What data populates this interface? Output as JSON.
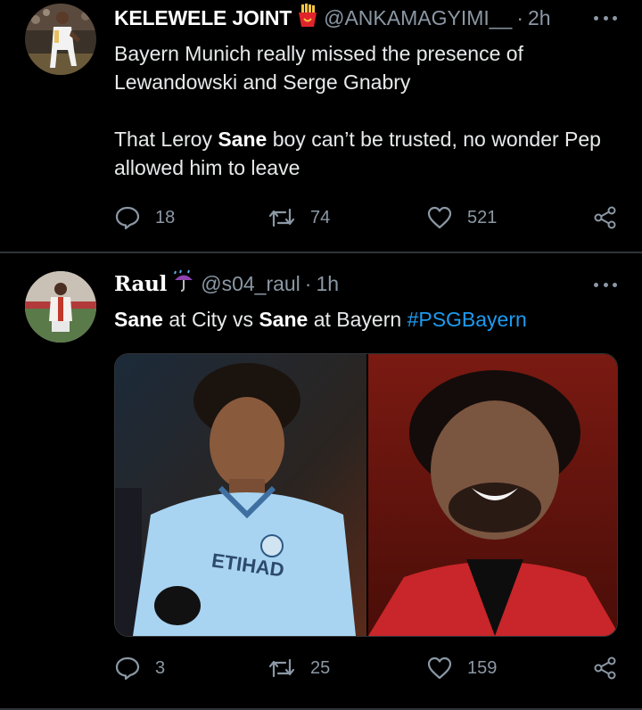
{
  "tweets": [
    {
      "display_name": "KELEWELE JOINT",
      "name_emoji": "fries-emoji",
      "handle": "@ANKAMAGYIMI__",
      "separator": "·",
      "time": "2h",
      "paragraph1": "Bayern Munich really missed the presence of Lewandowski and Serge Gnabry",
      "paragraph2_prefix": "That Leroy ",
      "paragraph2_bold": "Sane",
      "paragraph2_suffix": " boy can’t be trusted, no wonder Pep allowed him to leave",
      "replies": "18",
      "retweets": "74",
      "likes": "521"
    },
    {
      "display_name": "Raul",
      "name_emoji": "umbrella-rain-emoji",
      "handle": "@s04_raul",
      "separator": "·",
      "time": "1h",
      "text_bold1": "Sane",
      "text_mid1": " at City vs ",
      "text_bold2": "Sane",
      "text_mid2": " at Bayern ",
      "hashtag": "#PSGBayern",
      "replies": "3",
      "retweets": "25",
      "likes": "159"
    }
  ],
  "icons": {
    "reply": "reply-bubble-icon",
    "retweet": "retweet-arrows-icon",
    "like": "heart-icon",
    "share": "share-nodes-icon",
    "more": "more-dots-icon"
  },
  "colors": {
    "background": "#000000",
    "secondary_text": "#8b98a5",
    "link": "#1d9bf0",
    "divider": "#2f3336"
  }
}
